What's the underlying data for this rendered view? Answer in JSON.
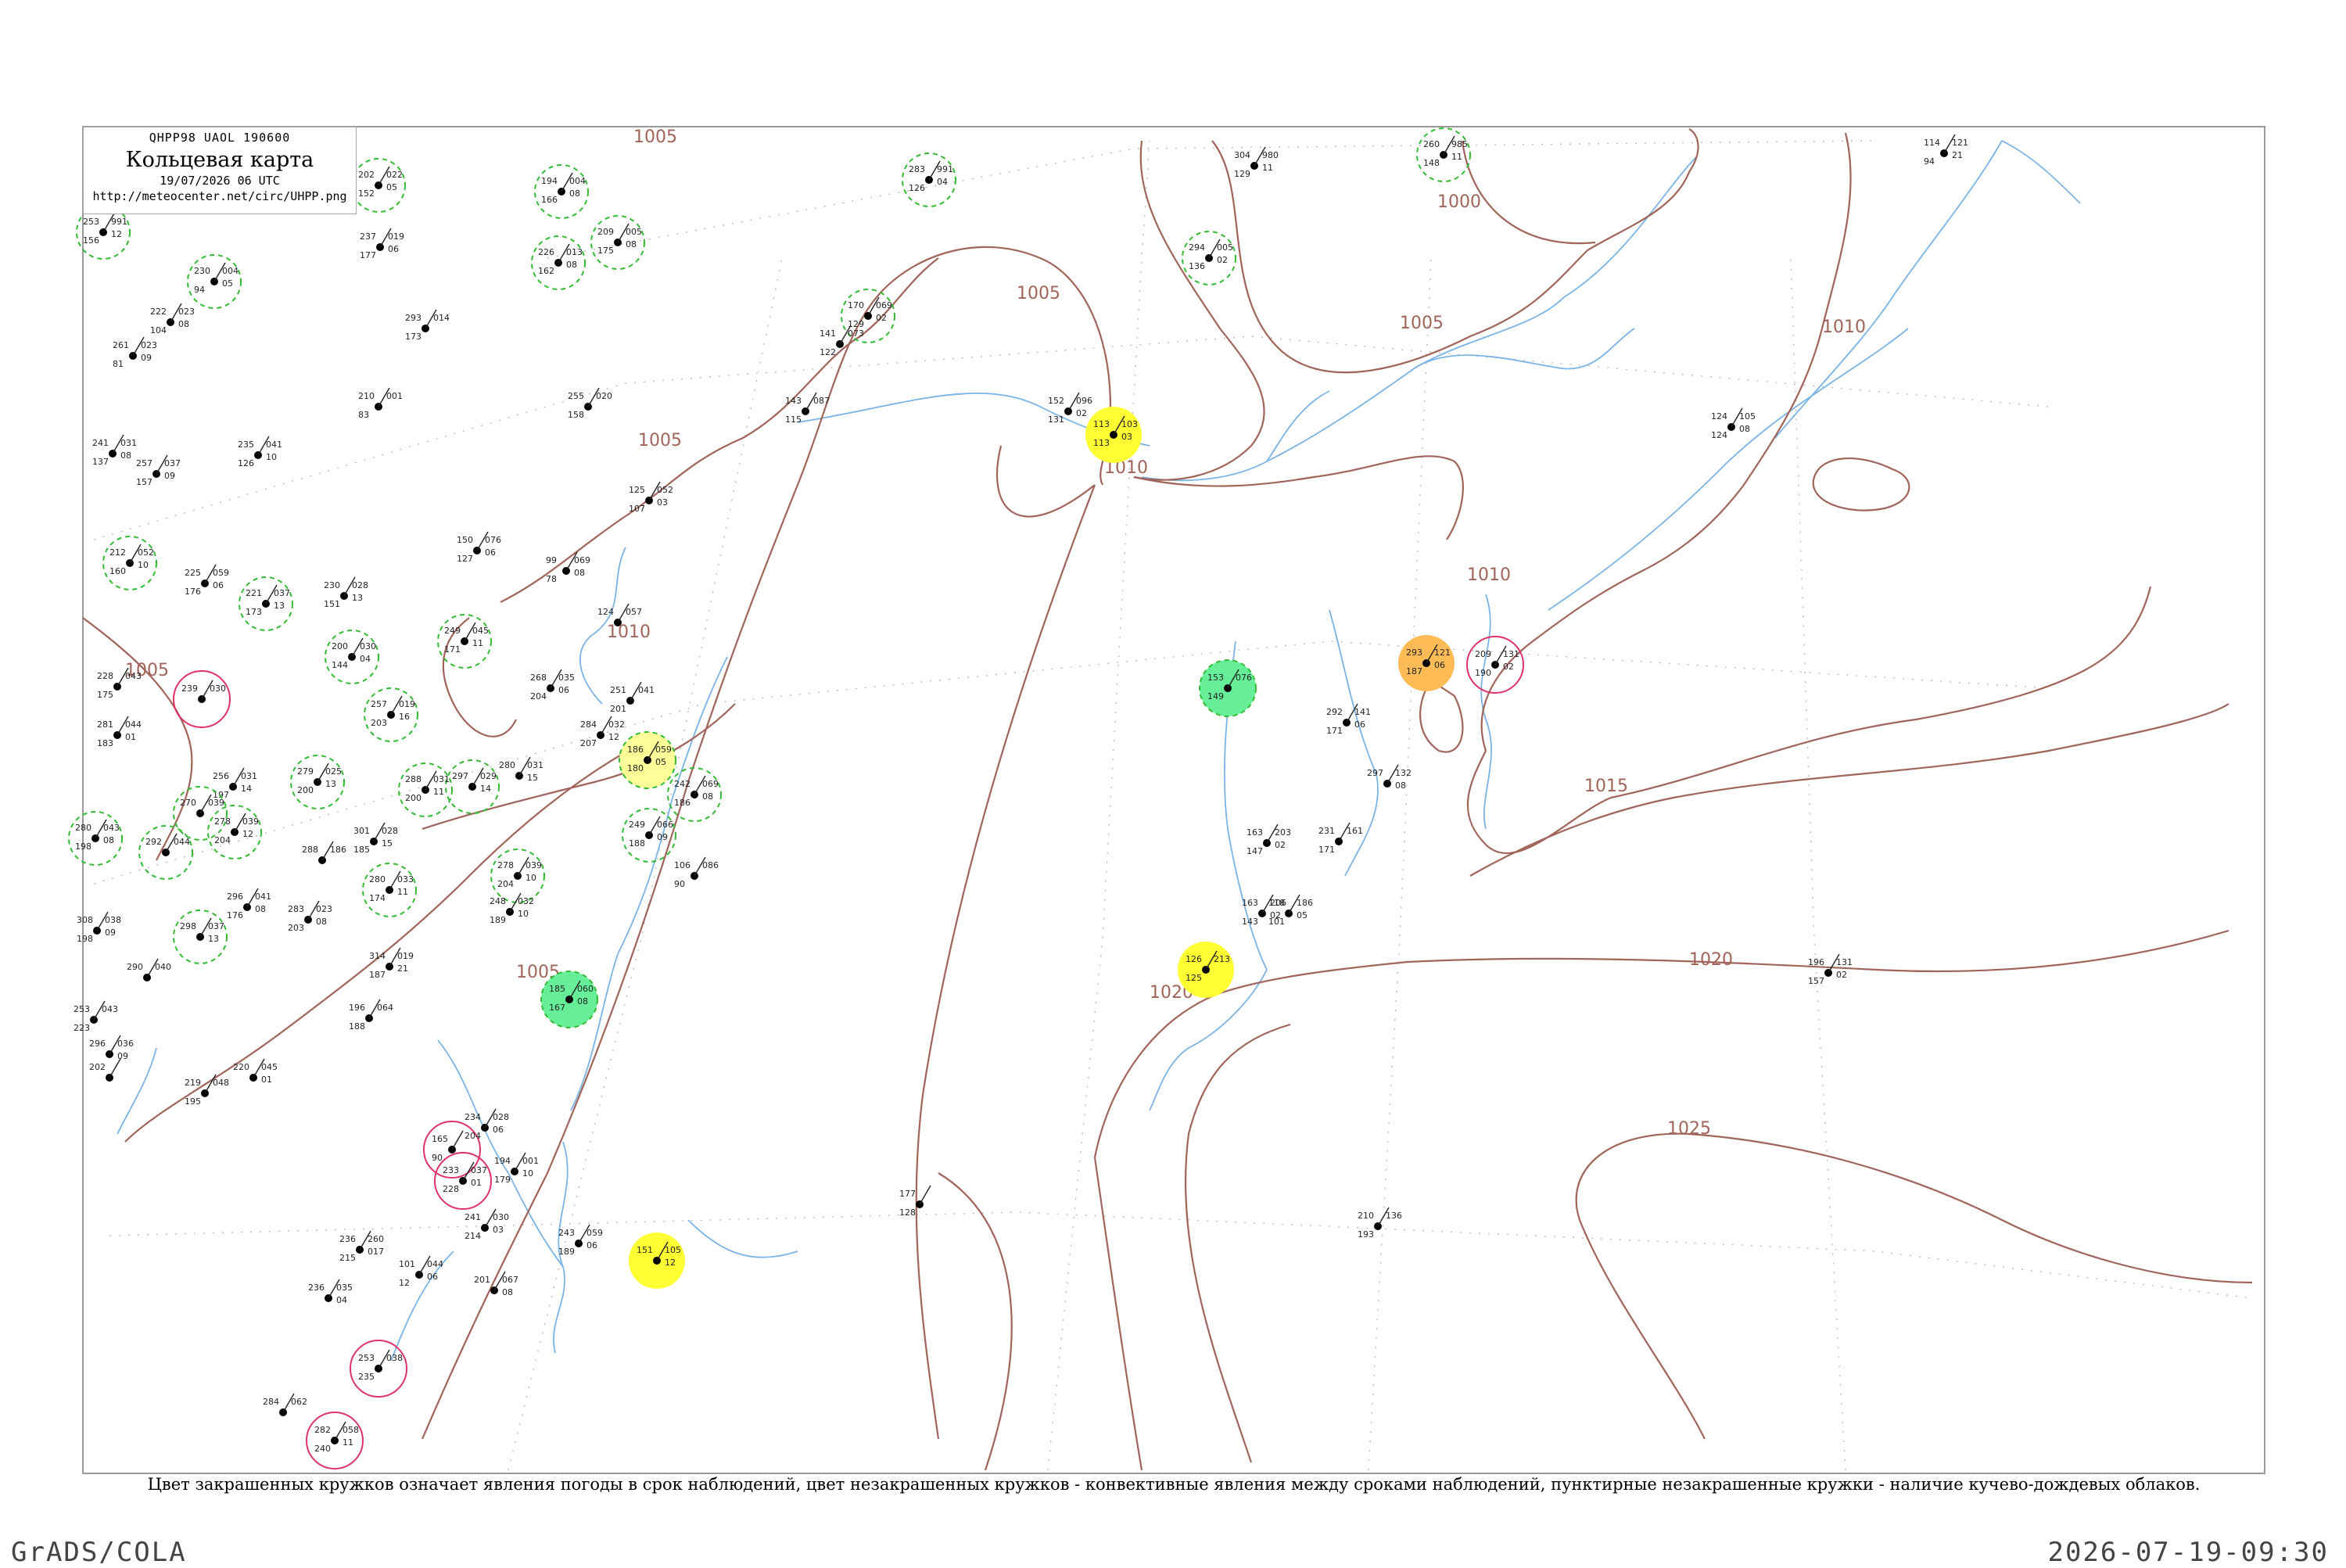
{
  "header": {
    "code": "QHPP98 UAOL 190600",
    "title": "Кольцевая карта",
    "datetime": "19/07/2026 06 UTC",
    "url": "http://meteocenter.net/circ/UHPP.png"
  },
  "caption": "Цвет закрашенных кружков означает явления погоды в срок наблюдений, цвет незакрашенных кружков - конвективные явления между сроками наблюдений, пунктирные незакрашенные кружки - наличие кучево-дождевых облаков.",
  "footer": {
    "left": "GrADS/COLA",
    "right": "2026-07-19-09:30"
  },
  "colors": {
    "isobar": "#a0645a",
    "river": "#7ab4e6",
    "graticule": "#b0b0b0",
    "rain": "#00bb33",
    "light_rain": "#66ee99",
    "thunderstorm": "#ee3355",
    "fog": "#ffff33",
    "haze": "#ffbb55",
    "cb_dashed": "#33bb33",
    "thunder_open": "#dd3366"
  },
  "isobar_labels": [
    "1005",
    "1010",
    "1005",
    "1010",
    "1000",
    "1005",
    "1010",
    "1015",
    "1020",
    "1020",
    "1025",
    "1005",
    "1005",
    "1005",
    "1010"
  ],
  "stations": [
    {
      "t": "253",
      "p": "991",
      "td": "156",
      "d": "12",
      "cls": "cb"
    },
    {
      "t": "202",
      "p": "022",
      "td": "152",
      "d": "05",
      "cls": "cb"
    },
    {
      "t": "194",
      "p": "004",
      "td": "166",
      "d": "08",
      "cls": "cb"
    },
    {
      "t": "283",
      "p": "991",
      "td": "126",
      "d": "04",
      "cls": "cb"
    },
    {
      "t": "304",
      "p": "980",
      "td": "129",
      "d": "11",
      "cls": "plain"
    },
    {
      "t": "260",
      "p": "985",
      "td": "148",
      "d": "11",
      "cls": "cb"
    },
    {
      "t": "114",
      "p": "121",
      "td": "94",
      "d": "21",
      "cls": "plain"
    },
    {
      "t": "230",
      "p": "004",
      "td": "94",
      "d": "05",
      "cls": "cb"
    },
    {
      "t": "222",
      "p": "023",
      "td": "104",
      "d": "08",
      "cls": "plain"
    },
    {
      "t": "261",
      "p": "023",
      "td": "81",
      "d": "09",
      "cls": "plain"
    },
    {
      "t": "237",
      "p": "019",
      "td": "177",
      "d": "06",
      "cls": "plain"
    },
    {
      "t": "226",
      "p": "013",
      "td": "162",
      "d": "08",
      "cls": "cb"
    },
    {
      "t": "209",
      "p": "005",
      "td": "175",
      "d": "08",
      "cls": "cb"
    },
    {
      "t": "293",
      "p": "014",
      "td": "173",
      "d": "",
      "cls": "plain"
    },
    {
      "t": "294",
      "p": "005",
      "td": "136",
      "d": "02",
      "cls": "cb"
    },
    {
      "t": "170",
      "p": "069",
      "td": "129",
      "d": "02",
      "cls": "cb"
    },
    {
      "t": "141",
      "p": "073",
      "td": "122",
      "d": "",
      "cls": "plain"
    },
    {
      "t": "210",
      "p": "001",
      "td": "83",
      "d": "",
      "cls": "plain"
    },
    {
      "t": "255",
      "p": "020",
      "td": "158",
      "d": "",
      "cls": "plain"
    },
    {
      "t": "143",
      "p": "087",
      "td": "115",
      "d": "",
      "cls": "plain"
    },
    {
      "t": "152",
      "p": "096",
      "td": "131",
      "d": "02",
      "cls": "plain"
    },
    {
      "t": "113",
      "p": "103",
      "td": "113",
      "d": "03",
      "cls": "fog"
    },
    {
      "t": "124",
      "p": "105",
      "td": "124",
      "d": "08",
      "cls": "plain"
    },
    {
      "t": "241",
      "p": "031",
      "td": "137",
      "d": "08",
      "cls": "plain"
    },
    {
      "t": "257",
      "p": "037",
      "td": "157",
      "d": "09",
      "cls": "plain"
    },
    {
      "t": "235",
      "p": "041",
      "td": "126",
      "d": "10",
      "cls": "plain"
    },
    {
      "t": "125",
      "p": "052",
      "td": "107",
      "d": "03",
      "cls": "plain"
    },
    {
      "t": "150",
      "p": "076",
      "td": "127",
      "d": "06",
      "cls": "plain"
    },
    {
      "t": "99",
      "p": "069",
      "td": "78",
      "d": "08",
      "cls": "plain"
    },
    {
      "t": "212",
      "p": "052",
      "td": "160",
      "d": "10",
      "cls": "cb"
    },
    {
      "t": "225",
      "p": "059",
      "td": "176",
      "d": "06",
      "cls": "plain"
    },
    {
      "t": "221",
      "p": "037",
      "td": "173",
      "d": "13",
      "cls": "cb"
    },
    {
      "t": "230",
      "p": "028",
      "td": "151",
      "d": "13",
      "cls": "plain"
    },
    {
      "t": "249",
      "p": "045",
      "td": "171",
      "d": "11",
      "cls": "cb"
    },
    {
      "t": "124",
      "p": "057",
      "td": "",
      "d": "",
      "cls": "plain"
    },
    {
      "t": "200",
      "p": "030",
      "td": "144",
      "d": "04",
      "cls": "cb"
    },
    {
      "t": "239",
      "p": "030",
      "td": "",
      "d": "",
      "cls": "thunder"
    },
    {
      "t": "257",
      "p": "019",
      "td": "203",
      "d": "16",
      "cls": "cb"
    },
    {
      "t": "228",
      "p": "043",
      "td": "175",
      "d": "",
      "cls": "plain"
    },
    {
      "t": "268",
      "p": "035",
      "td": "204",
      "d": "06",
      "cls": "plain"
    },
    {
      "t": "251",
      "p": "041",
      "td": "201",
      "d": "",
      "cls": "plain"
    },
    {
      "t": "281",
      "p": "044",
      "td": "183",
      "d": "01",
      "cls": "plain"
    },
    {
      "t": "284",
      "p": "032",
      "td": "207",
      "d": "12",
      "cls": "plain"
    },
    {
      "t": "186",
      "p": "059",
      "td": "180",
      "d": "05",
      "cls": "lightfog"
    },
    {
      "t": "279",
      "p": "025",
      "td": "200",
      "d": "13",
      "cls": "cb"
    },
    {
      "t": "280",
      "p": "031",
      "td": "",
      "d": "15",
      "cls": "plain"
    },
    {
      "t": "256",
      "p": "031",
      "td": "197",
      "d": "14",
      "cls": "plain"
    },
    {
      "t": "297",
      "p": "029",
      "td": "",
      "d": "14",
      "cls": "cb"
    },
    {
      "t": "288",
      "p": "031",
      "td": "200",
      "d": "11",
      "cls": "cb"
    },
    {
      "t": "242",
      "p": "069",
      "td": "186",
      "d": "08",
      "cls": "cb"
    },
    {
      "t": "280",
      "p": "043",
      "td": "198",
      "d": "08",
      "cls": "cb"
    },
    {
      "t": "270",
      "p": "039",
      "td": "",
      "d": "",
      "cls": "cb"
    },
    {
      "t": "278",
      "p": "039",
      "td": "204",
      "d": "12",
      "cls": "cb"
    },
    {
      "t": "301",
      "p": "028",
      "td": "185",
      "d": "15",
      "cls": "plain"
    },
    {
      "t": "249",
      "p": "066",
      "td": "188",
      "d": "09",
      "cls": "cb"
    },
    {
      "t": "292",
      "p": "044",
      "td": "",
      "d": "",
      "cls": "cb"
    },
    {
      "t": "288",
      "p": "186",
      "td": "",
      "d": "",
      "cls": "plain"
    },
    {
      "t": "106",
      "p": "086",
      "td": "90",
      "d": "",
      "cls": "plain"
    },
    {
      "t": "278",
      "p": "039",
      "td": "204",
      "d": "10",
      "cls": "cb"
    },
    {
      "t": "296",
      "p": "041",
      "td": "176",
      "d": "08",
      "cls": "plain"
    },
    {
      "t": "298",
      "p": "037",
      "td": "",
      "d": "13",
      "cls": "cb"
    },
    {
      "t": "280",
      "p": "033",
      "td": "174",
      "d": "11",
      "cls": "cb"
    },
    {
      "t": "283",
      "p": "023",
      "td": "203",
      "d": "08",
      "cls": "plain"
    },
    {
      "t": "308",
      "p": "038",
      "td": "198",
      "d": "09",
      "cls": "plain"
    },
    {
      "t": "248",
      "p": "032",
      "td": "189",
      "d": "10",
      "cls": "plain"
    },
    {
      "t": "290",
      "p": "040",
      "td": "",
      "d": "",
      "cls": "plain"
    },
    {
      "t": "314",
      "p": "019",
      "td": "187",
      "d": "21",
      "cls": "plain"
    },
    {
      "t": "253",
      "p": "043",
      "td": "223",
      "d": "",
      "cls": "plain"
    },
    {
      "t": "196",
      "p": "064",
      "td": "188",
      "d": "",
      "cls": "plain"
    },
    {
      "t": "185",
      "p": "060",
      "td": "167",
      "d": "08",
      "cls": "lightrain"
    },
    {
      "t": "296",
      "p": "036",
      "td": "",
      "d": "09",
      "cls": "plain"
    },
    {
      "t": "202",
      "p": "",
      "td": "",
      "d": "",
      "cls": "plain"
    },
    {
      "t": "219",
      "p": "048",
      "td": "195",
      "d": "",
      "cls": "plain"
    },
    {
      "t": "220",
      "p": "045",
      "td": "",
      "d": "01",
      "cls": "plain"
    },
    {
      "t": "165",
      "p": "",
      "td": "90",
      "d": "",
      "cls": "thunder"
    },
    {
      "t": "234",
      "p": "028",
      "td": "204",
      "d": "06",
      "cls": "plain"
    },
    {
      "t": "194",
      "p": "001",
      "td": "179",
      "d": "10",
      "cls": "plain"
    },
    {
      "t": "233",
      "p": "037",
      "td": "228",
      "d": "01",
      "cls": "thunder"
    },
    {
      "t": "241",
      "p": "030",
      "td": "214",
      "d": "03",
      "cls": "plain"
    },
    {
      "t": "243",
      "p": "059",
      "td": "189",
      "d": "06",
      "cls": "plain"
    },
    {
      "t": "151",
      "p": "105",
      "td": "",
      "d": "12",
      "cls": "fog"
    },
    {
      "t": "236",
      "p": "260",
      "td": "215",
      "d": "017",
      "cls": "plain"
    },
    {
      "t": "101",
      "p": "044",
      "td": "12",
      "d": "06",
      "cls": "plain"
    },
    {
      "t": "201",
      "p": "067",
      "td": "",
      "d": "08",
      "cls": "plain"
    },
    {
      "t": "236",
      "p": "035",
      "td": "",
      "d": "04",
      "cls": "plain"
    },
    {
      "t": "253",
      "p": "038",
      "td": "235",
      "d": "",
      "cls": "thunder"
    },
    {
      "t": "284",
      "p": "062",
      "td": "",
      "d": "",
      "cls": "plain"
    },
    {
      "t": "282",
      "p": "058",
      "td": "240",
      "d": "11",
      "cls": "thunder"
    },
    {
      "t": "153",
      "p": "076",
      "td": "149",
      "d": "",
      "cls": "lightrain"
    },
    {
      "t": "293",
      "p": "121",
      "td": "187",
      "d": "06",
      "cls": "haze"
    },
    {
      "t": "209",
      "p": "131",
      "td": "190",
      "d": "02",
      "cls": "thunder"
    },
    {
      "t": "292",
      "p": "141",
      "td": "171",
      "d": "06",
      "cls": "plain"
    },
    {
      "t": "297",
      "p": "132",
      "td": "",
      "d": "08",
      "cls": "plain"
    },
    {
      "t": "163",
      "p": "203",
      "td": "147",
      "d": "02",
      "cls": "plain"
    },
    {
      "t": "231",
      "p": "161",
      "td": "171",
      "d": "",
      "cls": "plain"
    },
    {
      "t": "163",
      "p": "206",
      "td": "143",
      "d": "02",
      "cls": "plain"
    },
    {
      "t": "118",
      "p": "186",
      "td": "101",
      "d": "05",
      "cls": "plain"
    },
    {
      "t": "126",
      "p": "213",
      "td": "125",
      "d": "",
      "cls": "fog"
    },
    {
      "t": "196",
      "p": "131",
      "td": "157",
      "d": "02",
      "cls": "plain"
    },
    {
      "t": "177",
      "p": "",
      "td": "128",
      "d": "",
      "cls": "plain"
    },
    {
      "t": "210",
      "p": "136",
      "td": "193",
      "d": "",
      "cls": "plain"
    }
  ]
}
